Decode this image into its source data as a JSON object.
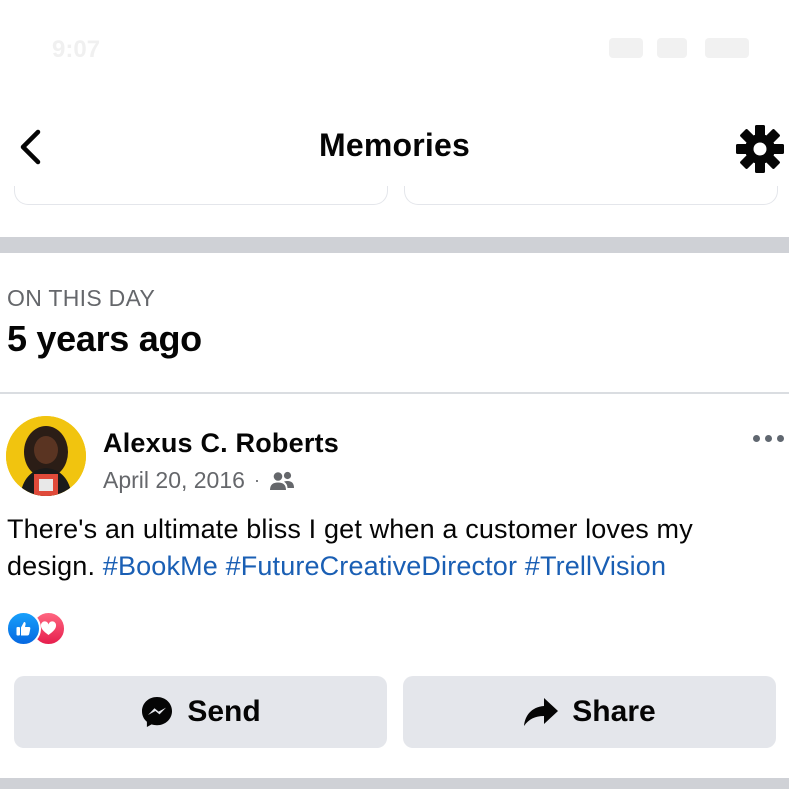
{
  "status_bar": {
    "time": "9:07"
  },
  "header": {
    "title": "Memories"
  },
  "section": {
    "label": "ON THIS DAY",
    "heading": "5 years ago"
  },
  "post": {
    "author": "Alexus C. Roberts",
    "date": "April 20, 2016",
    "meta_separator": "·",
    "audience_icon": "friends-icon",
    "text": "There's an ultimate bliss I get when a customer loves my design. ",
    "hashtags": [
      "#BookMe",
      "#FutureCreativeDirector",
      "#TrellVision"
    ],
    "reactions": [
      "like-icon",
      "love-icon"
    ]
  },
  "actions": {
    "send_label": "Send",
    "send_icon": "messenger-icon",
    "share_label": "Share",
    "share_icon": "share-arrow-icon"
  },
  "colors": {
    "hashtag": "#1a5fb4",
    "secondary_text": "#65676b",
    "button_bg": "#e4e6eb",
    "like": "#1877f2",
    "love": "#f33e58"
  }
}
